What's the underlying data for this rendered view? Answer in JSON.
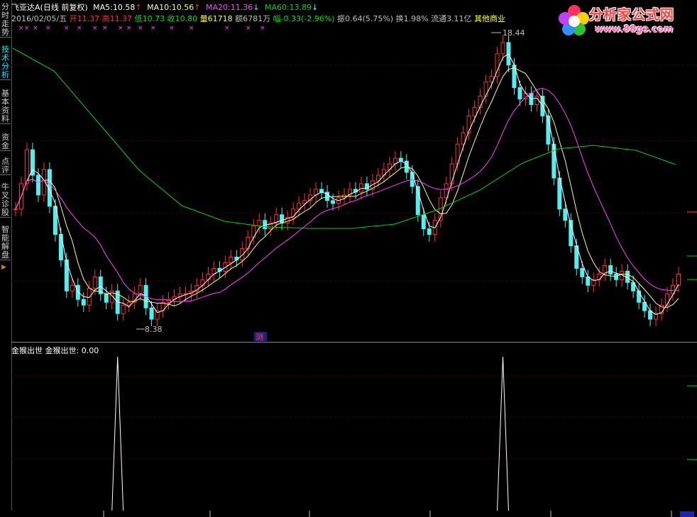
{
  "sidebar": {
    "tabs": [
      {
        "label": "分时走势",
        "active": false
      },
      {
        "label": "技术分析",
        "active": true
      },
      {
        "label": "基本资料",
        "active": false
      },
      {
        "label": "资金",
        "active": false
      },
      {
        "label": "点评",
        "active": false
      },
      {
        "label": "牛叉诊股",
        "active": false
      },
      {
        "label": "智能解盘",
        "active": false
      }
    ]
  },
  "header": {
    "stock_name": "飞亚达A",
    "mode": "(日线 前复权)",
    "ma5_label": "MA5:",
    "ma5_value": "10.58",
    "ma10_label": "MA10:",
    "ma10_value": "10.56",
    "ma20_label": "MA20:",
    "ma20_value": "11.36",
    "ma60_label": "MA60:",
    "ma60_value": "13.89",
    "date": "2016/02/05/五",
    "open_label": "开",
    "open_value": "11.37",
    "high_label": "高",
    "high_value": "11.37",
    "low_label": "低",
    "low_value": "10.73",
    "close_label": "收",
    "close_value": "10.80",
    "vol_label": "量",
    "vol_value": "61718",
    "amt_label": "额",
    "amt_value": "6781万",
    "chg_label": "幅",
    "chg_value": "-0.33(-2.96%)",
    "amp_label": "振",
    "amp_value": "0.64(5.75%)",
    "turn_label": "换",
    "turn_value": "1.98%",
    "float_label": "流通",
    "float_value": "3.11亿",
    "sector": "其他商业"
  },
  "logo": {
    "text": "分析家公式网",
    "url": "www.88gs.com"
  },
  "price_chart": {
    "high_marker": "18.44",
    "low_marker": "8.38",
    "badge": "测",
    "colors": {
      "ma5": "#ffffff",
      "ma10": "#ffff80",
      "ma20": "#ff40ff",
      "ma60": "#00d000",
      "up": "#ff3030",
      "down": "#50f0f0"
    }
  },
  "indicator": {
    "title": "金猴出世",
    "line_label": "金猴出世:",
    "line_value": "0.00"
  },
  "chart_data": {
    "type": "line",
    "title": "金猴出世",
    "series": [
      {
        "name": "金猴出世",
        "signals": [
          {
            "bar_index": 18,
            "value": 1
          },
          {
            "bar_index": 86,
            "value": 1
          }
        ]
      }
    ],
    "price_extremes": {
      "high": 18.44,
      "low": 8.38
    }
  }
}
